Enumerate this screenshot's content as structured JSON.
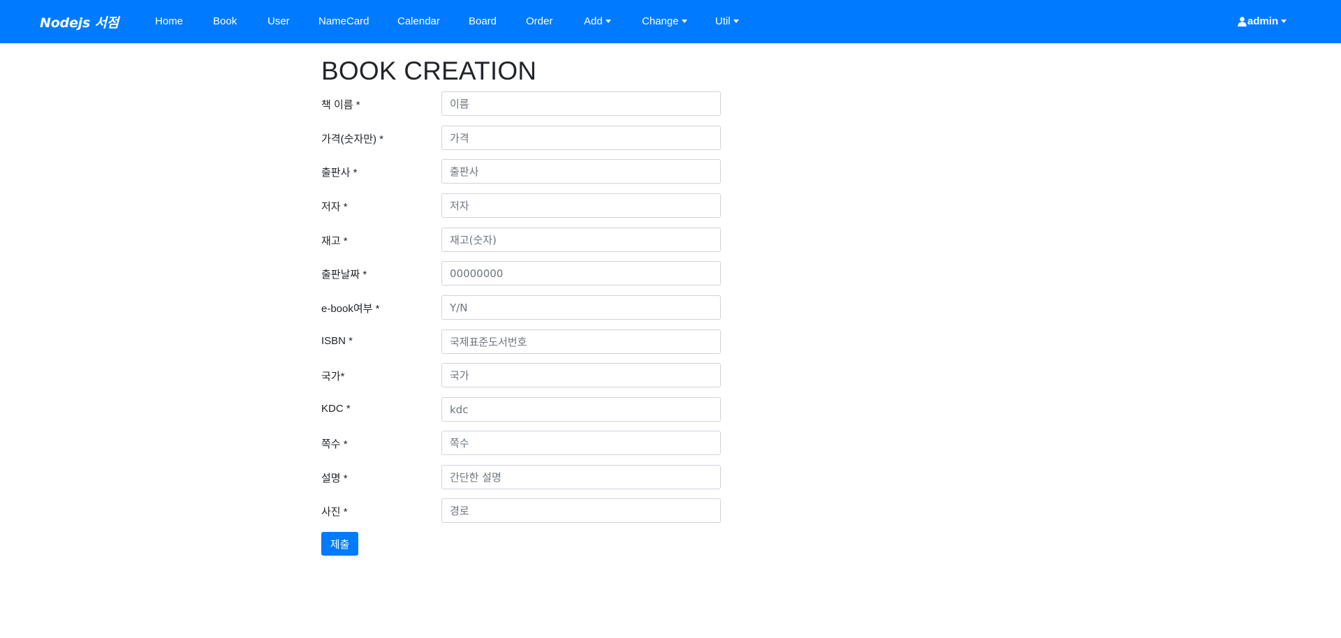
{
  "navbar": {
    "brand": "Nodejs 서점",
    "items": [
      {
        "label": "Home"
      },
      {
        "label": "Book"
      },
      {
        "label": "User"
      },
      {
        "label": "NameCard"
      },
      {
        "label": "Calendar"
      },
      {
        "label": "Board"
      },
      {
        "label": "Order"
      },
      {
        "label": "Add"
      },
      {
        "label": "Change"
      },
      {
        "label": "Util"
      }
    ],
    "user": "admin",
    "color": "#007bff"
  },
  "page": {
    "title": "BOOK CREATION"
  },
  "form": {
    "fields": [
      {
        "label": "책 이름 *",
        "placeholder": "이름",
        "value": ""
      },
      {
        "label": "가격(숫자만) *",
        "placeholder": "가격",
        "value": ""
      },
      {
        "label": "출판사 *",
        "placeholder": "출판사",
        "value": ""
      },
      {
        "label": "저자 *",
        "placeholder": "저자",
        "value": ""
      },
      {
        "label": "재고 *",
        "placeholder": "재고(숫자)",
        "value": ""
      },
      {
        "label": "출판날짜 *",
        "placeholder": "00000000",
        "value": ""
      },
      {
        "label": "e-book여부 *",
        "placeholder": "Y/N",
        "value": ""
      },
      {
        "label": "ISBN *",
        "placeholder": "국제표준도서번호",
        "value": ""
      },
      {
        "label": "국가*",
        "placeholder": "국가",
        "value": ""
      },
      {
        "label": "KDC *",
        "placeholder": "kdc",
        "value": ""
      },
      {
        "label": "쪽수 *",
        "placeholder": "쪽수",
        "value": ""
      },
      {
        "label": "설명 *",
        "placeholder": "간단한 설명",
        "value": ""
      },
      {
        "label": "사진 *",
        "placeholder": "경로",
        "value": ""
      }
    ],
    "submit_label": "제출"
  }
}
